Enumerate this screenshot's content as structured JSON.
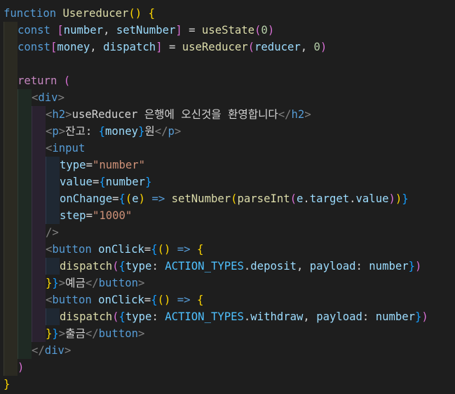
{
  "editor": {
    "language": "javascript-jsx",
    "theme_colors": {
      "background": "#1e1e1e",
      "keyword": "#569cd6",
      "function": "#dcdcaa",
      "variable": "#9cdcfe",
      "constant": "#4fc1ff",
      "number": "#b5cea8",
      "string": "#ce9178",
      "control": "#c586c0",
      "bracket_yellow": "#ffd700",
      "bracket_purple": "#da70d6",
      "bracket_blue": "#179fff"
    },
    "lines": [
      {
        "indent": 0,
        "tokens": [
          [
            "kw",
            "function"
          ],
          [
            "txt",
            " "
          ],
          [
            "fn",
            "Usereducer"
          ],
          [
            "br1",
            "()"
          ],
          [
            "txt",
            " "
          ],
          [
            "br1",
            "{"
          ]
        ]
      },
      {
        "indent": 1,
        "tokens": [
          [
            "kw",
            "const"
          ],
          [
            "txt",
            " "
          ],
          [
            "br2",
            "["
          ],
          [
            "var",
            "number"
          ],
          [
            "txt",
            ", "
          ],
          [
            "var",
            "setNumber"
          ],
          [
            "br2",
            "]"
          ],
          [
            "txt",
            " = "
          ],
          [
            "fn",
            "useState"
          ],
          [
            "br2",
            "("
          ],
          [
            "num",
            "0"
          ],
          [
            "br2",
            ")"
          ]
        ]
      },
      {
        "indent": 1,
        "tokens": [
          [
            "kw",
            "const"
          ],
          [
            "br2",
            "["
          ],
          [
            "var",
            "money"
          ],
          [
            "txt",
            ", "
          ],
          [
            "var",
            "dispatch"
          ],
          [
            "br2",
            "]"
          ],
          [
            "txt",
            " = "
          ],
          [
            "fn",
            "useReducer"
          ],
          [
            "br2",
            "("
          ],
          [
            "var",
            "reducer"
          ],
          [
            "txt",
            ", "
          ],
          [
            "num",
            "0"
          ],
          [
            "br2",
            ")"
          ]
        ]
      },
      {
        "indent": 1,
        "tokens": []
      },
      {
        "indent": 1,
        "tokens": [
          [
            "ctrl",
            "return"
          ],
          [
            "txt",
            " "
          ],
          [
            "br2",
            "("
          ]
        ]
      },
      {
        "indent": 2,
        "tokens": [
          [
            "brkt",
            "<"
          ],
          [
            "tag",
            "div"
          ],
          [
            "brkt",
            ">"
          ]
        ]
      },
      {
        "indent": 3,
        "tokens": [
          [
            "brkt",
            "<"
          ],
          [
            "tag",
            "h2"
          ],
          [
            "brkt",
            ">"
          ],
          [
            "txt",
            "useReducer 은행에 오신것을 환영합니다"
          ],
          [
            "brkt",
            "</"
          ],
          [
            "tag",
            "h2"
          ],
          [
            "brkt",
            ">"
          ]
        ]
      },
      {
        "indent": 3,
        "tokens": [
          [
            "brkt",
            "<"
          ],
          [
            "tag",
            "p"
          ],
          [
            "brkt",
            ">"
          ],
          [
            "txt",
            "잔고: "
          ],
          [
            "br3",
            "{"
          ],
          [
            "var",
            "money"
          ],
          [
            "br3",
            "}"
          ],
          [
            "txt",
            "원"
          ],
          [
            "brkt",
            "</"
          ],
          [
            "tag",
            "p"
          ],
          [
            "brkt",
            ">"
          ]
        ]
      },
      {
        "indent": 3,
        "tokens": [
          [
            "brkt",
            "<"
          ],
          [
            "tag",
            "input"
          ]
        ]
      },
      {
        "indent": 4,
        "tokens": [
          [
            "attr",
            "type"
          ],
          [
            "txt",
            "="
          ],
          [
            "str",
            "\"number\""
          ]
        ]
      },
      {
        "indent": 4,
        "tokens": [
          [
            "attr",
            "value"
          ],
          [
            "txt",
            "="
          ],
          [
            "br3",
            "{"
          ],
          [
            "var",
            "number"
          ],
          [
            "br3",
            "}"
          ]
        ]
      },
      {
        "indent": 4,
        "tokens": [
          [
            "attr",
            "onChange"
          ],
          [
            "txt",
            "="
          ],
          [
            "br3",
            "{"
          ],
          [
            "br1",
            "("
          ],
          [
            "var",
            "e"
          ],
          [
            "br1",
            ")"
          ],
          [
            "txt",
            " "
          ],
          [
            "kw",
            "=>"
          ],
          [
            "txt",
            " "
          ],
          [
            "fn",
            "setNumber"
          ],
          [
            "br1",
            "("
          ],
          [
            "fn",
            "parseInt"
          ],
          [
            "br2",
            "("
          ],
          [
            "var",
            "e"
          ],
          [
            "txt",
            "."
          ],
          [
            "var",
            "target"
          ],
          [
            "txt",
            "."
          ],
          [
            "var",
            "value"
          ],
          [
            "br2",
            ")"
          ],
          [
            "br1",
            ")"
          ],
          [
            "br3",
            "}"
          ]
        ]
      },
      {
        "indent": 4,
        "tokens": [
          [
            "attr",
            "step"
          ],
          [
            "txt",
            "="
          ],
          [
            "str",
            "\"1000\""
          ]
        ]
      },
      {
        "indent": 3,
        "tokens": [
          [
            "brkt",
            "/>"
          ]
        ]
      },
      {
        "indent": 3,
        "tokens": [
          [
            "brkt",
            "<"
          ],
          [
            "tag",
            "button"
          ],
          [
            "txt",
            " "
          ],
          [
            "attr",
            "onClick"
          ],
          [
            "txt",
            "="
          ],
          [
            "br3",
            "{"
          ],
          [
            "br1",
            "()"
          ],
          [
            "txt",
            " "
          ],
          [
            "kw",
            "=>"
          ],
          [
            "txt",
            " "
          ],
          [
            "br1",
            "{"
          ]
        ]
      },
      {
        "indent": 4,
        "tokens": [
          [
            "fn",
            "dispatch"
          ],
          [
            "br2",
            "("
          ],
          [
            "br3",
            "{"
          ],
          [
            "var",
            "type"
          ],
          [
            "txt",
            ": "
          ],
          [
            "const",
            "ACTION_TYPES"
          ],
          [
            "txt",
            "."
          ],
          [
            "var",
            "deposit"
          ],
          [
            "txt",
            ", "
          ],
          [
            "var",
            "payload"
          ],
          [
            "txt",
            ": "
          ],
          [
            "var",
            "number"
          ],
          [
            "br3",
            "}"
          ],
          [
            "br2",
            ")"
          ]
        ]
      },
      {
        "indent": 3,
        "tokens": [
          [
            "br1",
            "}"
          ],
          [
            "br3",
            "}"
          ],
          [
            "brkt",
            ">"
          ],
          [
            "txt",
            "예금"
          ],
          [
            "brkt",
            "</"
          ],
          [
            "tag",
            "button"
          ],
          [
            "brkt",
            ">"
          ]
        ]
      },
      {
        "indent": 3,
        "tokens": [
          [
            "brkt",
            "<"
          ],
          [
            "tag",
            "button"
          ],
          [
            "txt",
            " "
          ],
          [
            "attr",
            "onClick"
          ],
          [
            "txt",
            "="
          ],
          [
            "br3",
            "{"
          ],
          [
            "br1",
            "()"
          ],
          [
            "txt",
            " "
          ],
          [
            "kw",
            "=>"
          ],
          [
            "txt",
            " "
          ],
          [
            "br1",
            "{"
          ]
        ]
      },
      {
        "indent": 4,
        "tokens": [
          [
            "fn",
            "dispatch"
          ],
          [
            "br2",
            "("
          ],
          [
            "br3",
            "{"
          ],
          [
            "var",
            "type"
          ],
          [
            "txt",
            ": "
          ],
          [
            "const",
            "ACTION_TYPES"
          ],
          [
            "txt",
            "."
          ],
          [
            "var",
            "withdraw"
          ],
          [
            "txt",
            ", "
          ],
          [
            "var",
            "payload"
          ],
          [
            "txt",
            ": "
          ],
          [
            "var",
            "number"
          ],
          [
            "br3",
            "}"
          ],
          [
            "br2",
            ")"
          ]
        ]
      },
      {
        "indent": 3,
        "tokens": [
          [
            "br1",
            "}"
          ],
          [
            "br3",
            "}"
          ],
          [
            "brkt",
            ">"
          ],
          [
            "txt",
            "출금"
          ],
          [
            "brkt",
            "</"
          ],
          [
            "tag",
            "button"
          ],
          [
            "brkt",
            ">"
          ]
        ]
      },
      {
        "indent": 2,
        "tokens": [
          [
            "brkt",
            "</"
          ],
          [
            "tag",
            "div"
          ],
          [
            "brkt",
            ">"
          ]
        ]
      },
      {
        "indent": 1,
        "tokens": [
          [
            "br2",
            ")"
          ]
        ]
      },
      {
        "indent": 0,
        "tokens": [
          [
            "br1",
            "}"
          ]
        ]
      }
    ]
  }
}
